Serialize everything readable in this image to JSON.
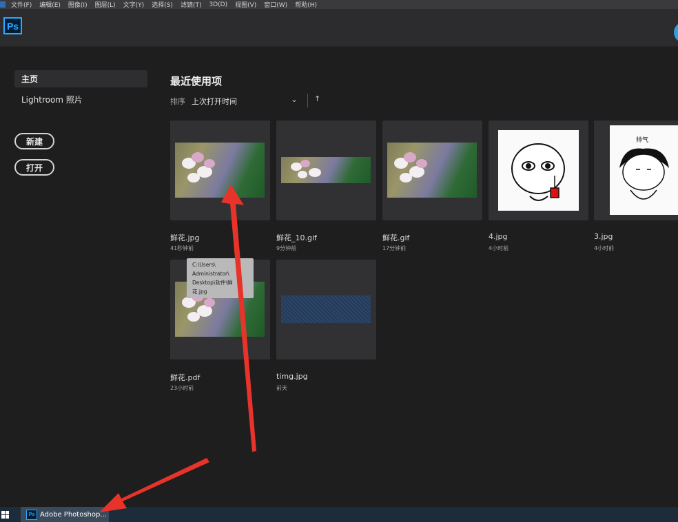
{
  "menubar": {
    "items": [
      "文件(F)",
      "编辑(E)",
      "图像(I)",
      "图层(L)",
      "文字(Y)",
      "选择(S)",
      "滤镜(T)",
      "3D(D)",
      "视图(V)",
      "窗口(W)",
      "帮助(H)"
    ]
  },
  "app": {
    "logo_text": "Ps"
  },
  "sidebar": {
    "items": [
      {
        "label": "主页"
      },
      {
        "label": "Lightroom 照片"
      }
    ],
    "new_button": "新建",
    "open_button": "打开"
  },
  "recent": {
    "title": "最近使用项",
    "sort_label": "排序",
    "sort_value": "上次打开时间",
    "files": [
      {
        "name": "鲜花.jpg",
        "time": "41秒钟前"
      },
      {
        "name": "鲜花_10.gif",
        "time": "9分钟前"
      },
      {
        "name": "鲜花.gif",
        "time": "17分钟前"
      },
      {
        "name": "4.jpg",
        "time": "4小时前"
      },
      {
        "name": "3.jpg",
        "time": "4小时前"
      },
      {
        "name": "鲜花.pdf",
        "time": "23小时前"
      },
      {
        "name": "timg.jpg",
        "time": "前天"
      }
    ],
    "tooltip_lines": [
      "C:\\Users\\",
      "Administrator\\",
      "Desktop\\软件\\鲜",
      "花.jpg"
    ],
    "meme_caption": "帅气"
  },
  "taskbar": {
    "app_label": "Adobe Photoshop..."
  },
  "colors": {
    "accent": "#31a8ff",
    "annotation": "#e8332a"
  }
}
